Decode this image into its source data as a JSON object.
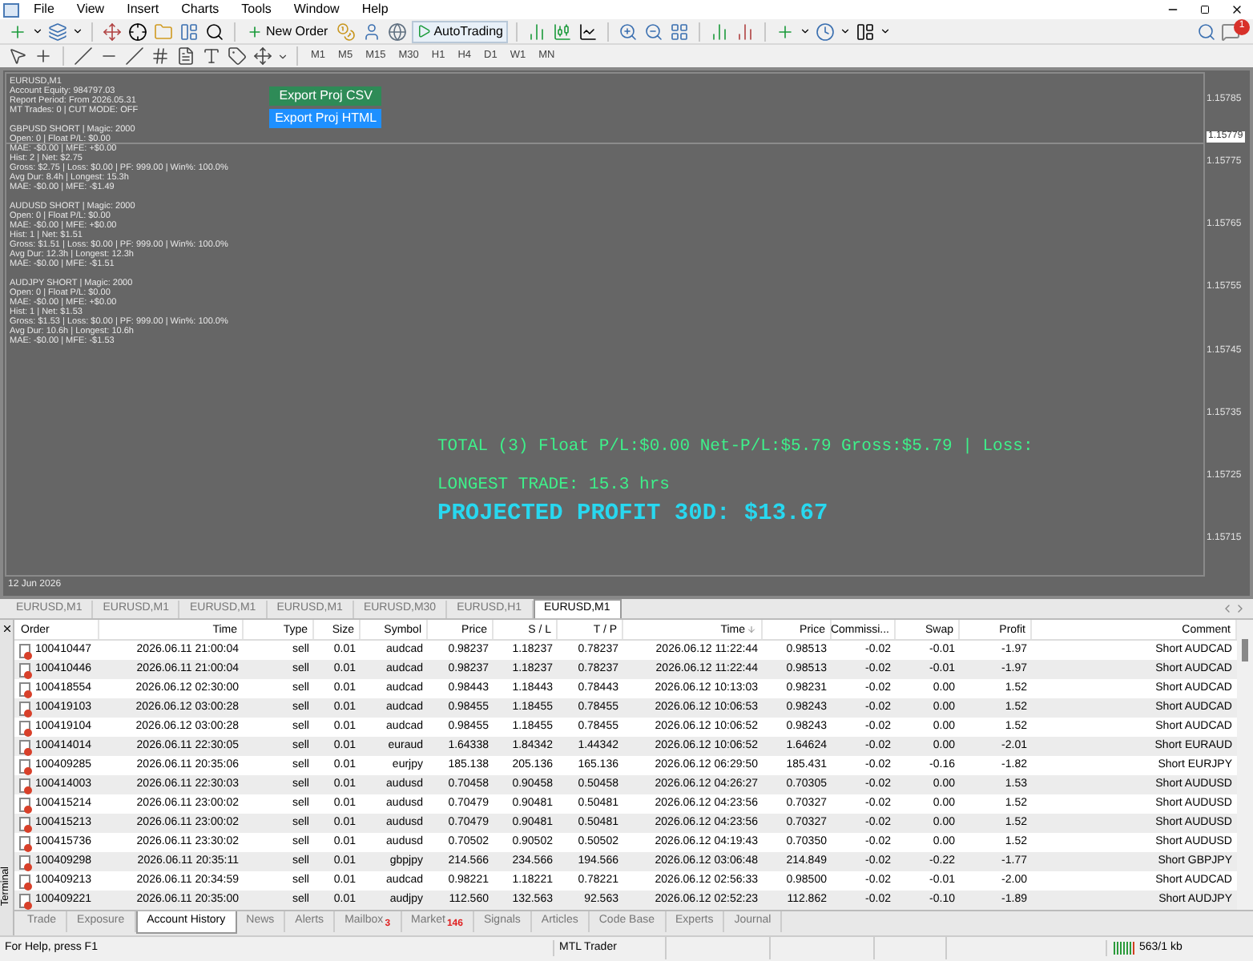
{
  "menu": [
    "File",
    "View",
    "Insert",
    "Charts",
    "Tools",
    "Window",
    "Help"
  ],
  "toolbar": {
    "new_order": "New Order",
    "autotrading": "AutoTrading",
    "notifications_badge": "1"
  },
  "timeframes": [
    "M1",
    "M5",
    "M15",
    "M30",
    "H1",
    "H4",
    "D1",
    "W1",
    "MN"
  ],
  "chart": {
    "header": [
      "EURUSD,M1",
      "Account Equity: 984797.03",
      "Report Period: From 2026.05.31",
      "MT Trades: 0 | CUT MODE: OFF"
    ],
    "buttons": [
      {
        "label": "Export Proj CSV",
        "color": "#2e8b57"
      },
      {
        "label": "Export Proj HTML",
        "color": "#1e90ff"
      }
    ],
    "blocks": [
      [
        "GBPUSD SHORT | Magic: 2000",
        "Open: 0 | Float P/L: $0.00",
        "MAE: -$0.00 | MFE: +$0.00",
        "Hist: 2 | Net: $2.75",
        "Gross: $2.75 | Loss: $0.00 | PF: 999.00 | Win%: 100.0%",
        "Avg Dur: 8.4h | Longest: 15.3h",
        "MAE: -$0.00 | MFE: -$1.49"
      ],
      [
        "AUDUSD SHORT | Magic: 2000",
        "Open: 0 | Float P/L: $0.00",
        "MAE: -$0.00 | MFE: +$0.00",
        "Hist: 1 | Net: $1.51",
        "Gross: $1.51 | Loss: $0.00 | PF: 999.00 | Win%: 100.0%",
        "Avg Dur: 12.3h | Longest: 12.3h",
        "MAE: -$0.00 | MFE: -$1.51"
      ],
      [
        "AUDJPY SHORT | Magic: 2000",
        "Open: 0 | Float P/L: $0.00",
        "MAE: -$0.00 | MFE: +$0.00",
        "Hist: 1 | Net: $1.53",
        "Gross: $1.53 | Loss: $0.00 | PF: 999.00 | Win%: 100.0%",
        "Avg Dur: 10.6h | Longest: 10.6h",
        "MAE: -$0.00 | MFE: -$1.53"
      ]
    ],
    "total": "TOTAL (3) Float P/L:$0.00 Net-P/L:$5.79 Gross:$5.79 | Loss:",
    "longest": "LONGEST TRADE: 15.3 hrs",
    "projected": "PROJECTED PROFIT 30D: $13.67",
    "current_price": "1.15779",
    "price_ticks": [
      "1.15785",
      "1.15775",
      "1.15765",
      "1.15755",
      "1.15745",
      "1.15735",
      "1.15725",
      "1.15715"
    ],
    "date": "12 Jun 2026"
  },
  "chart_tabs": [
    {
      "label": "EURUSD,M1",
      "selected": false
    },
    {
      "label": "EURUSD,M1",
      "selected": false
    },
    {
      "label": "EURUSD,M1",
      "selected": false
    },
    {
      "label": "EURUSD,M1",
      "selected": false
    },
    {
      "label": "EURUSD,M30",
      "selected": false
    },
    {
      "label": "EURUSD,H1",
      "selected": false
    },
    {
      "label": "EURUSD,M1",
      "selected": true
    }
  ],
  "terminal": {
    "side_label": "Terminal",
    "columns": [
      "Order",
      "Time",
      "Type",
      "Size",
      "Symbol",
      "Price",
      "S / L",
      "T / P",
      "Time",
      "Price",
      "Commissi...",
      "Swap",
      "Profit",
      "Comment"
    ],
    "rows": [
      [
        "100410447",
        "2026.06.11 21:00:04",
        "sell",
        "0.01",
        "audcad",
        "0.98237",
        "1.18237",
        "0.78237",
        "2026.06.12 11:22:44",
        "0.98513",
        "-0.02",
        "-0.01",
        "-1.97",
        "Short AUDCAD"
      ],
      [
        "100410446",
        "2026.06.11 21:00:04",
        "sell",
        "0.01",
        "audcad",
        "0.98237",
        "1.18237",
        "0.78237",
        "2026.06.12 11:22:44",
        "0.98513",
        "-0.02",
        "-0.01",
        "-1.97",
        "Short AUDCAD"
      ],
      [
        "100418554",
        "2026.06.12 02:30:00",
        "sell",
        "0.01",
        "audcad",
        "0.98443",
        "1.18443",
        "0.78443",
        "2026.06.12 10:13:03",
        "0.98231",
        "-0.02",
        "0.00",
        "1.52",
        "Short AUDCAD"
      ],
      [
        "100419103",
        "2026.06.12 03:00:28",
        "sell",
        "0.01",
        "audcad",
        "0.98455",
        "1.18455",
        "0.78455",
        "2026.06.12 10:06:53",
        "0.98243",
        "-0.02",
        "0.00",
        "1.52",
        "Short AUDCAD"
      ],
      [
        "100419104",
        "2026.06.12 03:00:28",
        "sell",
        "0.01",
        "audcad",
        "0.98455",
        "1.18455",
        "0.78455",
        "2026.06.12 10:06:52",
        "0.98243",
        "-0.02",
        "0.00",
        "1.52",
        "Short AUDCAD"
      ],
      [
        "100414014",
        "2026.06.11 22:30:05",
        "sell",
        "0.01",
        "euraud",
        "1.64338",
        "1.84342",
        "1.44342",
        "2026.06.12 10:06:52",
        "1.64624",
        "-0.02",
        "0.00",
        "-2.01",
        "Short EURAUD"
      ],
      [
        "100409285",
        "2026.06.11 20:35:06",
        "sell",
        "0.01",
        "eurjpy",
        "185.138",
        "205.136",
        "165.136",
        "2026.06.12 06:29:50",
        "185.431",
        "-0.02",
        "-0.16",
        "-1.82",
        "Short EURJPY"
      ],
      [
        "100414003",
        "2026.06.11 22:30:03",
        "sell",
        "0.01",
        "audusd",
        "0.70458",
        "0.90458",
        "0.50458",
        "2026.06.12 04:26:27",
        "0.70305",
        "-0.02",
        "0.00",
        "1.53",
        "Short AUDUSD"
      ],
      [
        "100415214",
        "2026.06.11 23:00:02",
        "sell",
        "0.01",
        "audusd",
        "0.70479",
        "0.90481",
        "0.50481",
        "2026.06.12 04:23:56",
        "0.70327",
        "-0.02",
        "0.00",
        "1.52",
        "Short AUDUSD"
      ],
      [
        "100415213",
        "2026.06.11 23:00:02",
        "sell",
        "0.01",
        "audusd",
        "0.70479",
        "0.90481",
        "0.50481",
        "2026.06.12 04:23:56",
        "0.70327",
        "-0.02",
        "0.00",
        "1.52",
        "Short AUDUSD"
      ],
      [
        "100415736",
        "2026.06.11 23:30:02",
        "sell",
        "0.01",
        "audusd",
        "0.70502",
        "0.90502",
        "0.50502",
        "2026.06.12 04:19:43",
        "0.70350",
        "-0.02",
        "0.00",
        "1.52",
        "Short AUDUSD"
      ],
      [
        "100409298",
        "2026.06.11 20:35:11",
        "sell",
        "0.01",
        "gbpjpy",
        "214.566",
        "234.566",
        "194.566",
        "2026.06.12 03:06:48",
        "214.849",
        "-0.02",
        "-0.22",
        "-1.77",
        "Short GBPJPY"
      ],
      [
        "100409213",
        "2026.06.11 20:34:59",
        "sell",
        "0.01",
        "audcad",
        "0.98221",
        "1.18221",
        "0.78221",
        "2026.06.12 02:56:33",
        "0.98500",
        "-0.02",
        "-0.01",
        "-2.00",
        "Short AUDCAD"
      ],
      [
        "100409221",
        "2026.06.11 20:35:00",
        "sell",
        "0.01",
        "audjpy",
        "112.560",
        "132.563",
        "92.563",
        "2026.06.12 02:52:23",
        "112.862",
        "-0.02",
        "-0.10",
        "-1.89",
        "Short AUDJPY"
      ]
    ],
    "tabs": [
      {
        "label": "Trade",
        "selected": false
      },
      {
        "label": "Exposure",
        "selected": false
      },
      {
        "label": "Account History",
        "selected": true
      },
      {
        "label": "News",
        "selected": false
      },
      {
        "label": "Alerts",
        "selected": false
      },
      {
        "label": "Mailbox",
        "badge": "3",
        "selected": false
      },
      {
        "label": "Market",
        "badge": "146",
        "selected": false
      },
      {
        "label": "Signals",
        "selected": false
      },
      {
        "label": "Articles",
        "selected": false
      },
      {
        "label": "Code Base",
        "selected": false
      },
      {
        "label": "Experts",
        "selected": false
      },
      {
        "label": "Journal",
        "selected": false
      }
    ]
  },
  "status_bar": {
    "help": "For Help, press F1",
    "profile": "MTL Trader",
    "traffic": "563/1 kb"
  }
}
